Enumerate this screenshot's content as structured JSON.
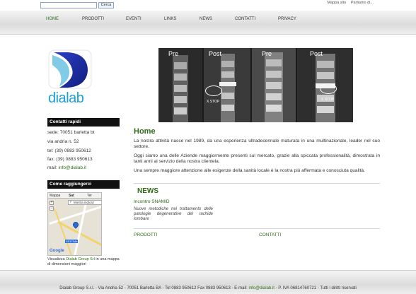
{
  "search": {
    "placeholder": "",
    "button_label": "Cerca"
  },
  "toplinks": [
    "Mappa sito",
    "Parliamo di..."
  ],
  "nav": [
    {
      "label": "HOME",
      "active": true
    },
    {
      "label": "PRODOTTI",
      "active": false
    },
    {
      "label": "EVENTI",
      "active": false
    },
    {
      "label": "LINKS",
      "active": false
    },
    {
      "label": "NEWS",
      "active": false
    },
    {
      "label": "CONTATTI",
      "active": false
    },
    {
      "label": "PRIVACY",
      "active": false
    }
  ],
  "logo": {
    "text": "dialab",
    "color": "#1aa0d3",
    "mark_color": "#1a2fa0"
  },
  "sidebar": {
    "contacts_title": "Contatti rapidi",
    "contacts": {
      "address1": "sede: 70051 barletta bt",
      "address2": "via andria n. 52",
      "tel": "tel: (39) 0883 950612",
      "fax": "fax: (39) 0883 950613",
      "mail_label": "mail:",
      "mail": "info@dialab.it"
    },
    "reach_title": "Come raggiungerci",
    "map": {
      "tabs": [
        "Mappa",
        "Sat",
        "Ter"
      ],
      "overlay_checkbox": "Mostra indicaz",
      "road_label": "SS170dir",
      "brand": "Google"
    },
    "map_caption": {
      "prefix": "Visualizza",
      "link": "Dialab Group Srl",
      "suffix": "in una mappa di dimensioni maggiori"
    }
  },
  "hero": {
    "labels": [
      "Pre",
      "Post",
      "Pre",
      "Post"
    ],
    "badge": "X STOP"
  },
  "main": {
    "title": "Home",
    "paragraphs": [
      "La nostra attività nasce nel 1989, da una esperienza ultradecennale maturata in una multinazionale, leader nel suo settore.",
      "Oggi siamo una delle Aziende maggiormente presenti sul mercato, grazie alla spiccata professionalità, dimostrata in tanti anni al servizio della nostra clientela.",
      "Una sempre maggiore attenzione alle esigenze della sanità locale è la nostra più affermata e conosciuta qualità."
    ]
  },
  "news": {
    "title": "NEWS",
    "headline": "Incontro SNAMID",
    "body": "Nuove metodiche nel trattamento delle patologie degenerative del rachide lombare"
  },
  "bottom_links": [
    "PRODOTTI",
    "CONTATTI"
  ],
  "footer": {
    "prefix": "Dialab Group S.r.l. - Via Andria 52 - 70051 Barletta BA - Tel 0883 950612 Fax 0883 950613 - E-mail:",
    "mail": "info@dialab.it",
    "suffix": "- P. IVA 06814760721 - Tutti i diritti riservati"
  },
  "colors": {
    "accent_green": "#2e6b17",
    "header_black": "#111111",
    "link_blue": "#1aa0d3"
  }
}
